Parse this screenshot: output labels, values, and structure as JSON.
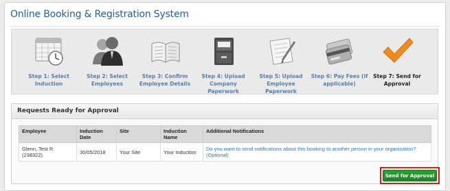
{
  "app": {
    "title": "Online Booking & Registration System"
  },
  "steps": [
    {
      "label": "Step 1: Select Induction",
      "icon": "calendar-icon",
      "current": false
    },
    {
      "label": "Step 2: Select Employees",
      "icon": "people-icon",
      "current": false
    },
    {
      "label": "Step 3: Confirm Employee Details",
      "icon": "open-book-icon",
      "current": false
    },
    {
      "label": "Step 4: Upload Company Paperwork",
      "icon": "file-cabinet-icon",
      "current": false
    },
    {
      "label": "Step 5: Upload Employee Paperwork",
      "icon": "paper-pen-icon",
      "current": false
    },
    {
      "label": "Step 6: Pay Fees (if applicable)",
      "icon": "credit-card-icon",
      "current": false
    },
    {
      "label": "Step 7: Send for Approval",
      "icon": "checkmark-icon",
      "current": true
    }
  ],
  "panel": {
    "title": "Requests Ready for Approval",
    "columns": [
      "Employee",
      "Induction Date",
      "Site",
      "Induction Name",
      "Additional Notifications"
    ],
    "rows": [
      {
        "employee": "Glenn, Test R (238322)",
        "date": "30/05/2018",
        "site": "Your Site",
        "induction": "Your Induction",
        "notification": "Do you want to send notifications about this booking to another person in your organisation? (Optional)"
      }
    ]
  },
  "actions": {
    "send_label": "Send for Approval"
  },
  "colors": {
    "accent": "#1f5f9e",
    "link": "#2e73b8",
    "button": "#2fa035",
    "highlight": "#e0161c"
  }
}
